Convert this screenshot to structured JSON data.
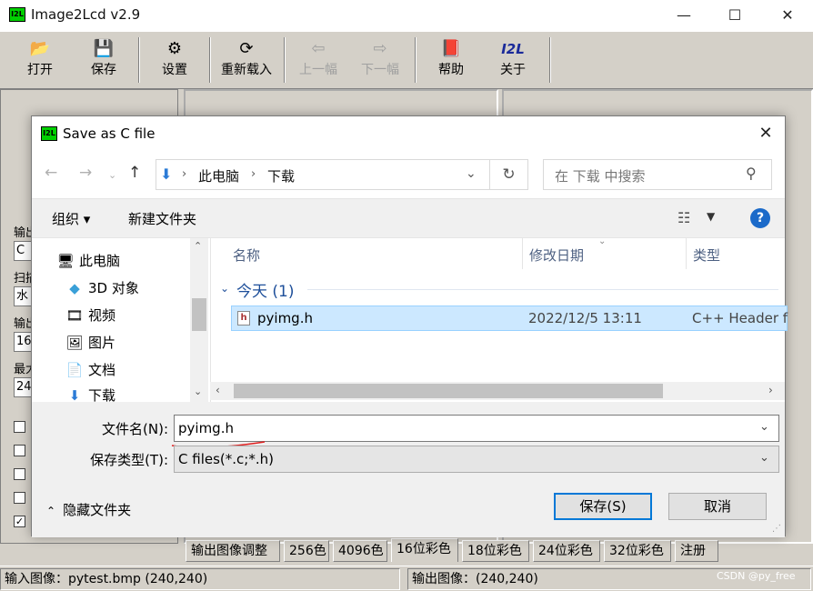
{
  "app": {
    "title": "Image2Lcd v2.9",
    "icon_text": "I2L",
    "toolbar": [
      {
        "label": "打开",
        "icon": "open-folder-icon",
        "glyph": "📂",
        "enabled": true
      },
      {
        "label": "保存",
        "icon": "save-icon",
        "glyph": "💾",
        "enabled": true
      },
      {
        "label": "设置",
        "icon": "settings-icon",
        "glyph": "⚙",
        "enabled": true
      },
      {
        "label": "重新载入",
        "icon": "reload-icon",
        "glyph": "⟳",
        "enabled": true
      },
      {
        "label": "上一幅",
        "icon": "prev-image-icon",
        "glyph": "⇦",
        "enabled": false
      },
      {
        "label": "下一幅",
        "icon": "next-image-icon",
        "glyph": "⇨",
        "enabled": false
      },
      {
        "label": "帮助",
        "icon": "help-book-icon",
        "glyph": "📕",
        "enabled": true
      },
      {
        "label": "关于",
        "icon": "about-logo-icon",
        "glyph": "I2L",
        "enabled": true
      }
    ],
    "left_panel": {
      "labels": [
        "输出",
        "扫描",
        "输出",
        "最大"
      ],
      "fields": [
        "C",
        "水",
        "16",
        "24"
      ],
      "checkbox_checked": [
        false,
        false,
        false,
        false,
        true
      ]
    },
    "tabs": [
      "输出图像调整",
      "256色",
      "4096色",
      "16位彩色",
      "18位彩色",
      "24位彩色",
      "32位彩色",
      "注册"
    ],
    "active_tab_index": 3,
    "status": {
      "input": "输入图像：pytest.bmp (240,240)",
      "output": "输出图像：(240,240)"
    },
    "watermark": "CSDN @py_free"
  },
  "dialog": {
    "title": "Save as C file",
    "address": {
      "parts": [
        "此电脑",
        "下载"
      ]
    },
    "search_placeholder": "在 下载 中搜索",
    "commands": {
      "organize": "组织 ▾",
      "new_folder": "新建文件夹"
    },
    "nav_items": [
      {
        "label": "此电脑",
        "icon": "this-pc-icon",
        "glyph": "🖥"
      },
      {
        "label": "3D 对象",
        "icon": "3d-objects-icon",
        "glyph": "◆"
      },
      {
        "label": "视频",
        "icon": "video-icon",
        "glyph": "🎞"
      },
      {
        "label": "图片",
        "icon": "pictures-icon",
        "glyph": "🖼"
      },
      {
        "label": "文档",
        "icon": "documents-icon",
        "glyph": "📄"
      },
      {
        "label": "下载",
        "icon": "downloads-icon",
        "glyph": "⬇"
      }
    ],
    "columns": [
      "名称",
      "修改日期",
      "类型"
    ],
    "group": "今天 (1)",
    "files": [
      {
        "name": "pyimg.h",
        "date": "2022/12/5 13:11",
        "type": "C++ Header f"
      }
    ],
    "filename_label": "文件名(N):",
    "filename_value": "pyimg.h",
    "filetype_label": "保存类型(T):",
    "filetype_value": "C files(*.c;*.h)",
    "hide_folders": "隐藏文件夹",
    "save_label": "保存(S)",
    "cancel_label": "取消",
    "accent_color": "#0078d7",
    "selection_color": "#cce8ff"
  }
}
